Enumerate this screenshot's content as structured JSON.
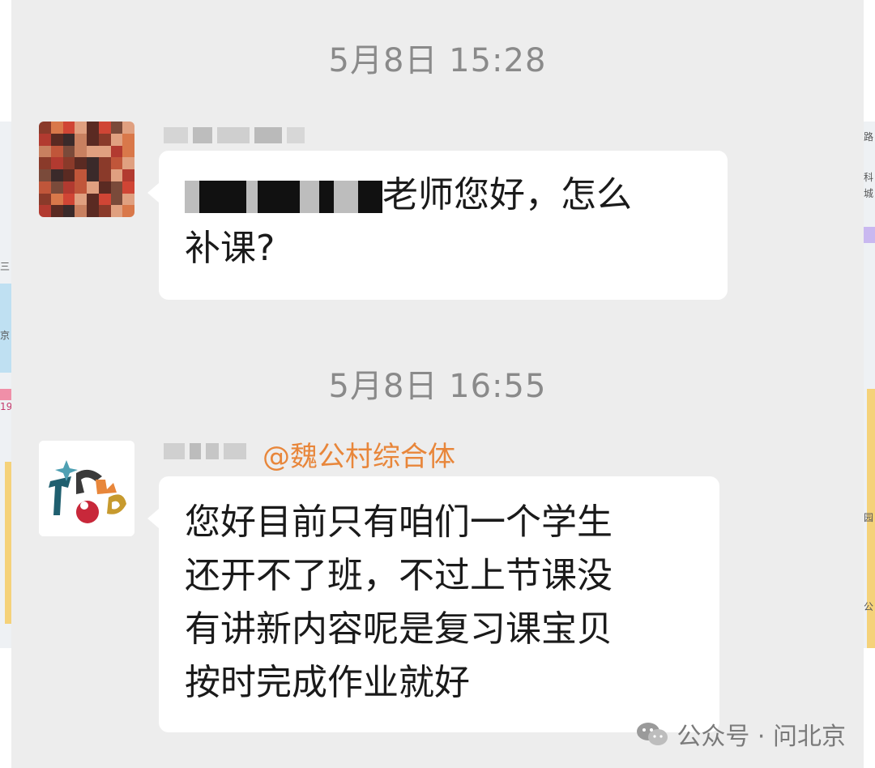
{
  "messages": [
    {
      "timestamp": "5月8日 15:28",
      "text_line1": "老师您好，怎么",
      "text_line2": "补课?"
    },
    {
      "timestamp": "5月8日 16:55",
      "mention": "@魏公村综合体",
      "lines": [
        "您好目前只有咱们一个学生",
        "还开不了班，不过上节课没",
        "有讲新内容呢是复习课宝贝",
        "按时完成作业就好"
      ]
    }
  ],
  "watermark": {
    "label": "公众号 · 问北京",
    "icon": "wechat-icon"
  },
  "map_labels": {
    "left": [
      "三",
      "京",
      "19"
    ],
    "right": [
      "路",
      "科",
      "城",
      "园",
      "公"
    ]
  },
  "colors": {
    "chat_bg": "#ededed",
    "bubble_bg": "#ffffff",
    "mention": "#e8863a",
    "timestamp": "#8a8a8a"
  }
}
